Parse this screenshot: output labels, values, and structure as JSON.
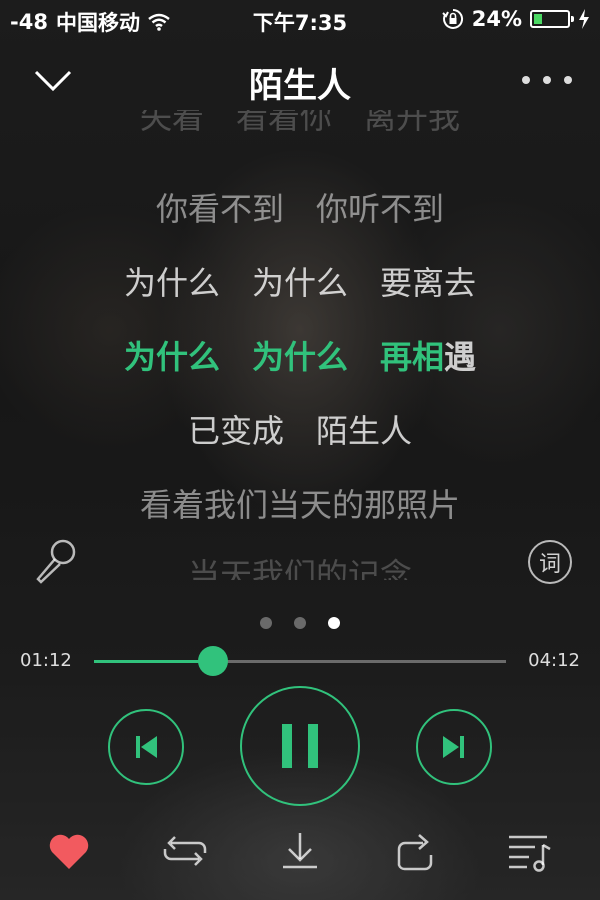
{
  "status_bar": {
    "signal": "-48",
    "carrier": "中国移动",
    "time": "下午7:35",
    "battery_percent": "24%",
    "battery_level": 0.24
  },
  "header": {
    "title": "陌生人"
  },
  "lyrics": {
    "lines": [
      {
        "parts": [
          {
            "text": "失着　看着你　离开我",
            "hl": false
          }
        ],
        "state": "faded"
      },
      {
        "parts": [
          {
            "text": "你看不到　你听不到",
            "hl": false
          }
        ],
        "state": "dim"
      },
      {
        "parts": [
          {
            "text": "为什么　为什么　要离去",
            "hl": false
          }
        ],
        "state": "normal"
      },
      {
        "parts": [
          {
            "text": "为什么　为什么　再相",
            "hl": true
          },
          {
            "text": "遇",
            "hl": false
          }
        ],
        "state": "current"
      },
      {
        "parts": [
          {
            "text": "已变成　陌生人",
            "hl": false
          }
        ],
        "state": "normal"
      },
      {
        "parts": [
          {
            "text": "看着我们当天的那照片",
            "hl": false
          }
        ],
        "state": "dim"
      },
      {
        "parts": [
          {
            "text": "当天我们的记念",
            "hl": false
          }
        ],
        "state": "faded"
      }
    ],
    "lyric_button": "词"
  },
  "pager": {
    "count": 3,
    "active": 2
  },
  "progress": {
    "current": "01:12",
    "total": "04:12",
    "fraction": 0.29
  },
  "colors": {
    "accent": "#31c27c",
    "heart": "#f25a5f"
  },
  "icons": {
    "back": "chevron-down-icon",
    "more": "more-icon",
    "mic": "microphone-icon",
    "prev": "skip-previous-icon",
    "play": "pause-icon",
    "next": "skip-next-icon",
    "favorite": "heart-icon",
    "mode": "repeat-icon",
    "download": "download-icon",
    "share": "share-icon",
    "playlist": "playlist-icon"
  }
}
